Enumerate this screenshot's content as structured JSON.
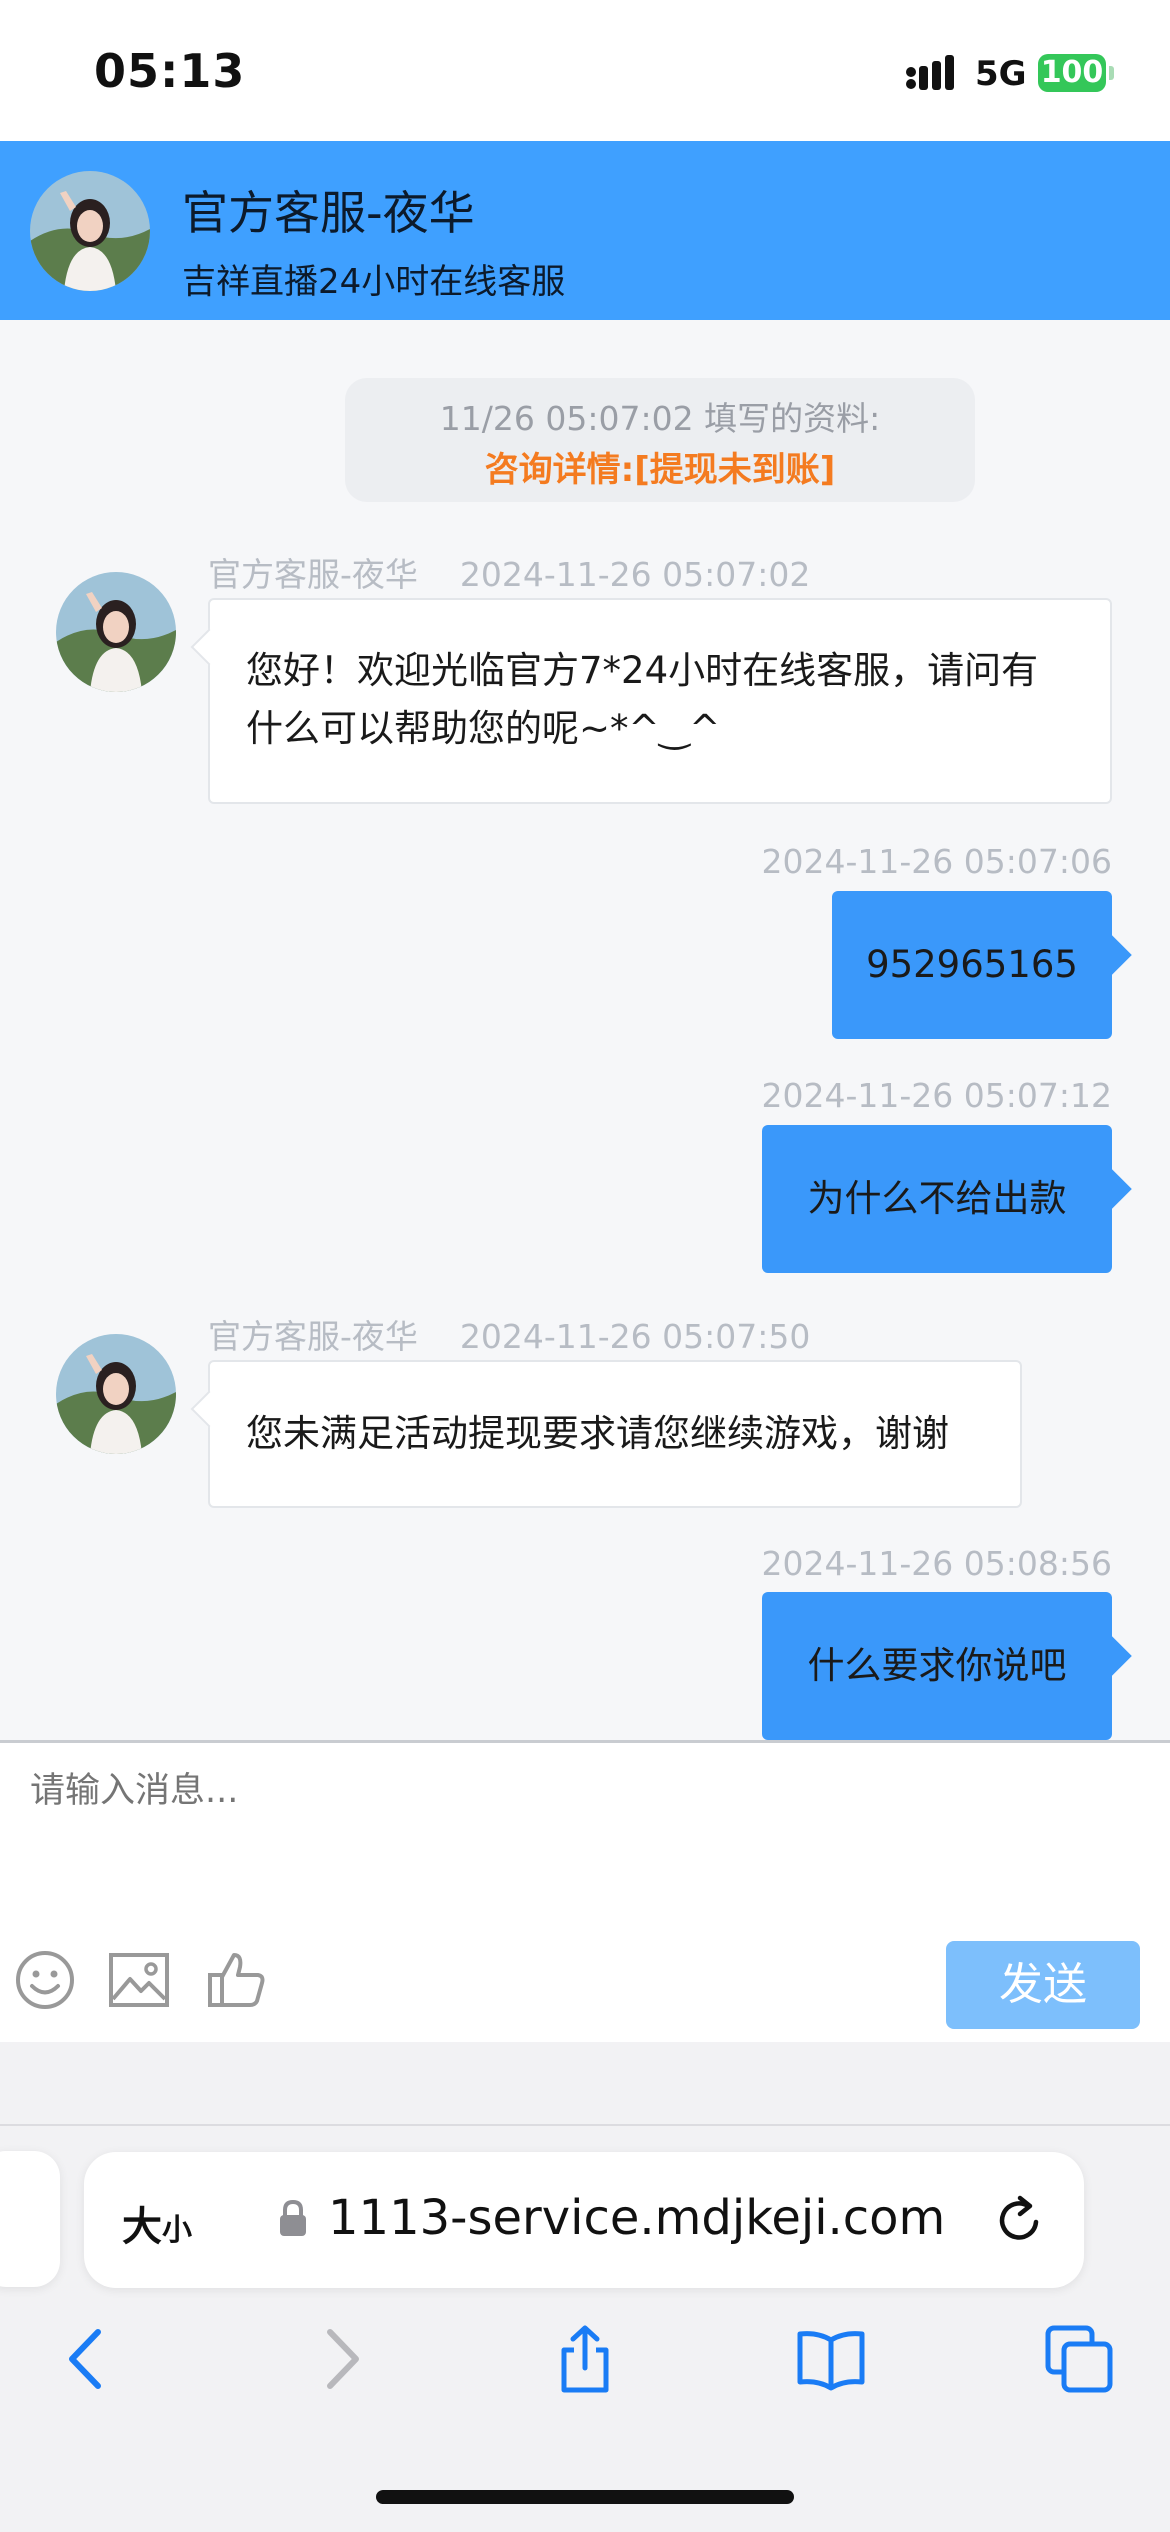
{
  "status_bar": {
    "time": "05:13",
    "network": "5G",
    "battery": "100"
  },
  "header": {
    "title": "官方客服-夜华",
    "subtitle": "吉祥直播24小时在线客服"
  },
  "system_notice": {
    "line1": "11/26 05:07:02 填写的资料:",
    "line2": "咨询详情:[提现未到账]"
  },
  "messages": [
    {
      "sender": "官方客服-夜华",
      "time": "2024-11-26 05:07:02",
      "text": "您好！欢迎光临官方7*24小时在线客服，请问有什么可以帮助您的呢~*^‿^"
    },
    {
      "time": "2024-11-26 05:07:06",
      "text": "952965165"
    },
    {
      "time": "2024-11-26 05:07:12",
      "text": "为什么不给出款"
    },
    {
      "sender": "官方客服-夜华",
      "time": "2024-11-26 05:07:50",
      "text": "您未满足活动提现要求请您继续游戏，谢谢"
    },
    {
      "time": "2024-11-26 05:08:56",
      "text": "什么要求你说吧"
    }
  ],
  "input": {
    "placeholder": "请输入消息...",
    "send_label": "发送"
  },
  "browser": {
    "text_size_big": "大",
    "text_size_small": "小",
    "url": "1113-service.mdjkeji.com"
  },
  "colors": {
    "header": "#3fa0ff",
    "outgoing_bubble": "#3a98fa",
    "notice_orange": "#f47b20",
    "send_button": "#7dbffc"
  },
  "icons": [
    "emoji-icon",
    "image-icon",
    "thumbs-up-icon",
    "lock-icon",
    "reload-icon",
    "back-icon",
    "forward-icon",
    "share-icon",
    "bookmarks-icon",
    "tabs-icon"
  ]
}
